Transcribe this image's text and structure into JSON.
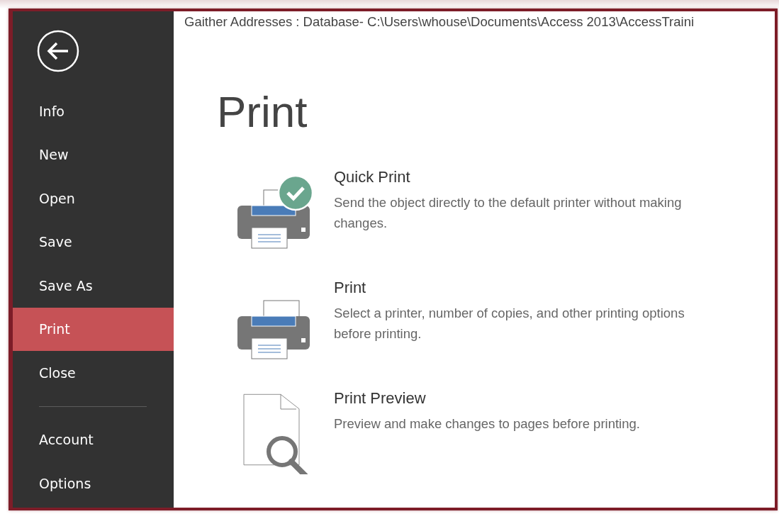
{
  "window": {
    "title": "Gaither Addresses : Database- C:\\Users\\whouse\\Documents\\Access 2013\\AccessTraini"
  },
  "sidebar": {
    "items": [
      {
        "label": "Info",
        "selected": false
      },
      {
        "label": "New",
        "selected": false
      },
      {
        "label": "Open",
        "selected": false
      },
      {
        "label": "Save",
        "selected": false
      },
      {
        "label": "Save As",
        "selected": false
      },
      {
        "label": "Print",
        "selected": true
      },
      {
        "label": "Close",
        "selected": false
      }
    ],
    "bottom_items": [
      {
        "label": "Account",
        "selected": false
      },
      {
        "label": "Options",
        "selected": false
      }
    ]
  },
  "page": {
    "heading": "Print",
    "options": [
      {
        "kind": "quick-print",
        "title": "Quick Print",
        "description": "Send the object directly to the default printer without making changes."
      },
      {
        "kind": "print",
        "title": "Print",
        "description": "Select a printer, number of copies, and other printing options before printing."
      },
      {
        "kind": "preview",
        "title": "Print Preview",
        "description": "Preview and make changes to pages before printing."
      }
    ]
  }
}
